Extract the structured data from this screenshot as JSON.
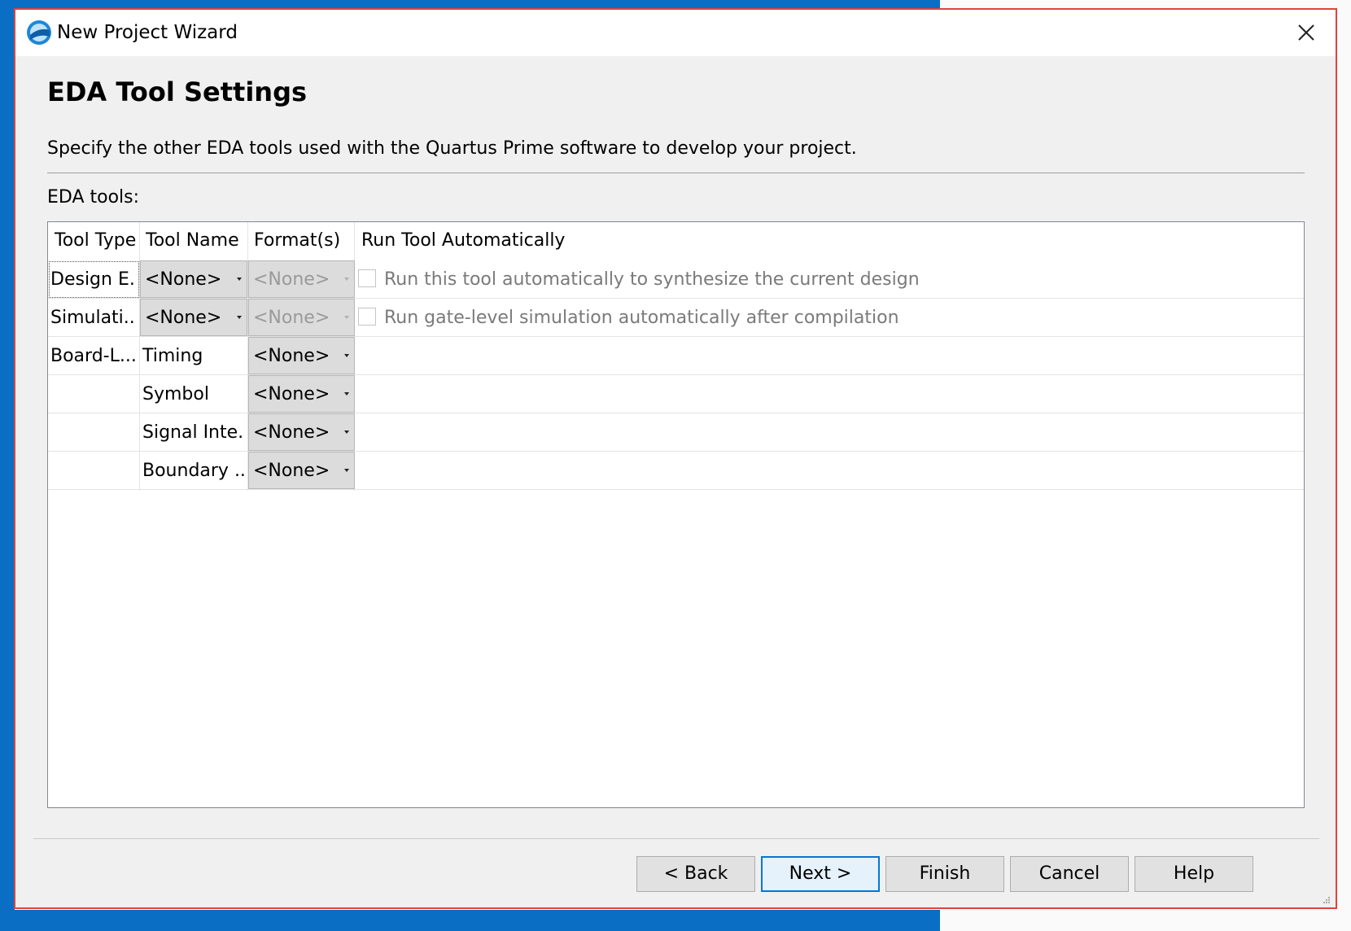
{
  "window": {
    "title": "New Project Wizard"
  },
  "page": {
    "title": "EDA Tool Settings",
    "description": "Specify the other EDA tools used with the Quartus Prime software to develop your project.",
    "tools_label": "EDA tools:"
  },
  "table": {
    "headers": [
      "Tool Type",
      "Tool Name",
      "Format(s)",
      "Run Tool Automatically"
    ],
    "rows": [
      {
        "tool_type": "Design E...",
        "tool_name": "<None>",
        "format": "<None>",
        "run_label": "Run this tool automatically to synthesize the current design"
      },
      {
        "tool_type": "Simulati...",
        "tool_name": "<None>",
        "format": "<None>",
        "run_label": "Run gate-level simulation automatically after compilation"
      },
      {
        "tool_type": "Board-L...",
        "tool_name": "Timing",
        "format": "<None>"
      },
      {
        "tool_type": "",
        "tool_name": "Symbol",
        "format": "<None>"
      },
      {
        "tool_type": "",
        "tool_name": "Signal Inte...",
        "format": "<None>"
      },
      {
        "tool_type": "",
        "tool_name": "Boundary ...",
        "format": "<None>"
      }
    ]
  },
  "buttons": {
    "back": "< Back",
    "next": "Next >",
    "finish": "Finish",
    "cancel": "Cancel",
    "help": "Help"
  },
  "colors": {
    "window_border": "#e0433a",
    "desktop": "#0a6ec4",
    "default_button": "#0078d7"
  }
}
